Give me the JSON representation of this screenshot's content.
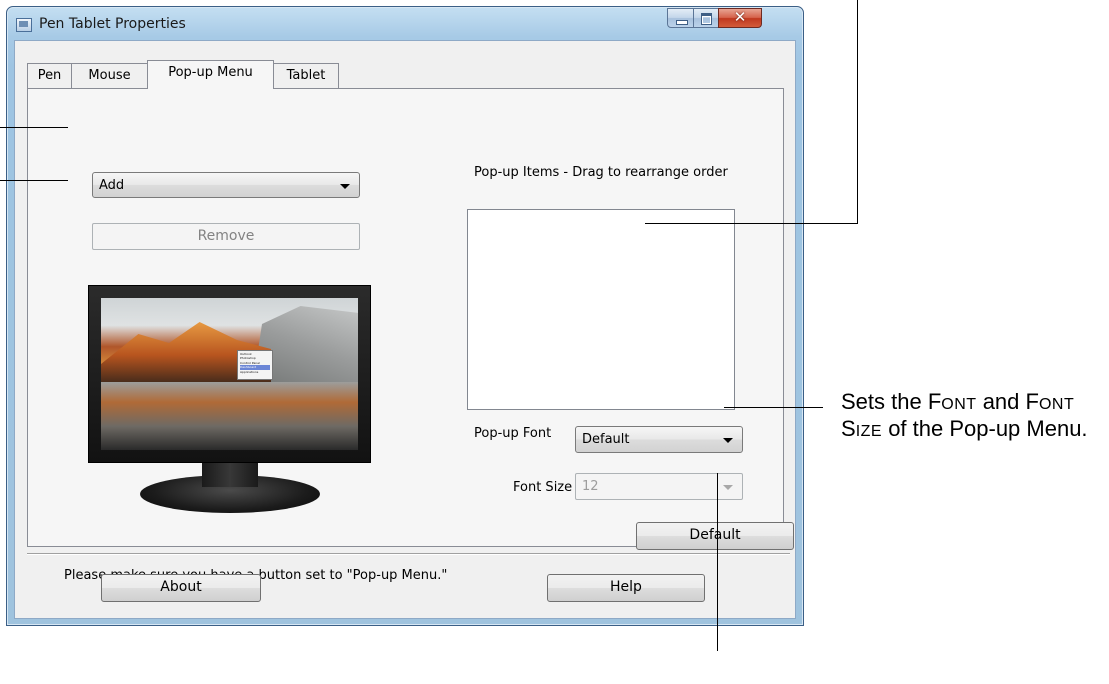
{
  "window": {
    "title": "Pen Tablet Properties"
  },
  "tabs": [
    {
      "label": "Pen",
      "active": false
    },
    {
      "label": "Mouse",
      "active": false
    },
    {
      "label": "Pop-up Menu",
      "active": true
    },
    {
      "label": "Tablet",
      "active": false
    }
  ],
  "left_panel": {
    "action_combo_value": "Add",
    "remove_button_label": "Remove",
    "remove_button_enabled": false,
    "preview_menu_items": [
      "Outlook",
      "Photoshop",
      "Control Panel",
      "Dashboard",
      "Applications"
    ],
    "preview_menu_highlighted_index": 3
  },
  "right_panel": {
    "popup_items_label": "Pop-up Items - Drag to rearrange order",
    "popup_items": [],
    "popup_font_label": "Pop-up Font",
    "popup_font_value": "Default",
    "font_size_label": "Font Size",
    "font_size_value": "12",
    "font_size_enabled": false,
    "default_button_label": "Default"
  },
  "note": "Please make sure you have a button set to \"Pop-up Menu.\"",
  "footer": {
    "about_button_label": "About",
    "help_button_label": "Help"
  },
  "callout": {
    "part1": "Sets the ",
    "sc1_first": "F",
    "sc1_rest": "ONT",
    "part2": " and ",
    "sc2_first": "F",
    "sc2_rest": "ONT",
    "part3": " ",
    "sc3_first": "S",
    "sc3_rest": "IZE",
    "part4": " of the Pop-up Menu."
  },
  "colors": {
    "window_frame": "#a7cae6",
    "dialog_bg": "#f0f0f0",
    "close_button": "#c0381f",
    "menu_highlight": "#6b86d6"
  }
}
